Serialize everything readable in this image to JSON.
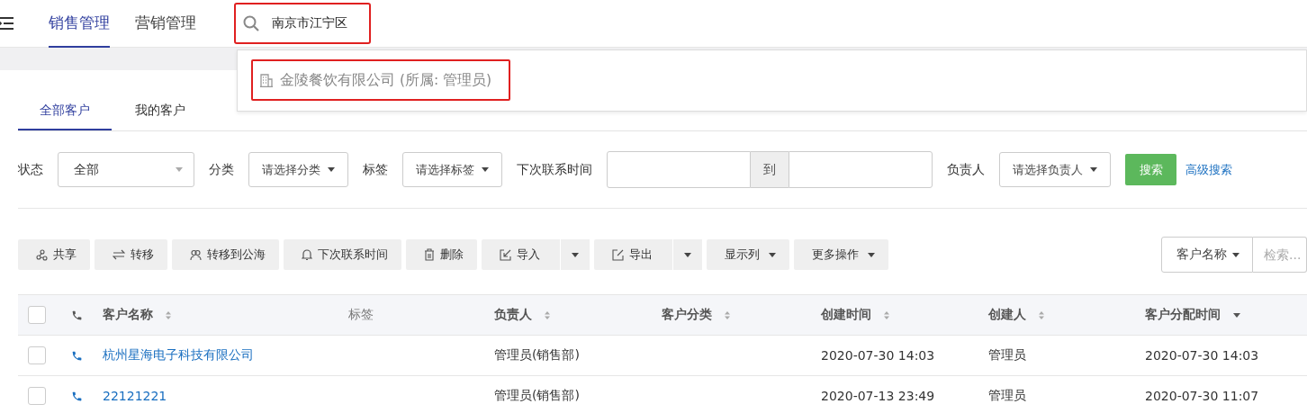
{
  "nav": {
    "tabs": [
      {
        "label": "销售管理",
        "selected": true
      },
      {
        "label": "营销管理",
        "selected": false
      }
    ]
  },
  "search": {
    "value": "南京市江宁区",
    "highlighted": true
  },
  "suggestions": [
    {
      "label": "金陵餐饮有限公司 (所属: 管理员)",
      "highlighted": true
    }
  ],
  "subtabs": [
    {
      "label": "全部客户",
      "selected": true
    },
    {
      "label": "我的客户",
      "selected": false
    }
  ],
  "filters": [
    {
      "kind": "select",
      "label": "状态",
      "value": "全部"
    },
    {
      "kind": "dropdown",
      "label": "分类",
      "value": "请选择分类"
    },
    {
      "kind": "dropdown",
      "label": "标签",
      "value": "请选择标签"
    },
    {
      "kind": "range",
      "label": "下次联系时间",
      "separator": "到"
    },
    {
      "kind": "dropdown",
      "label": "负责人",
      "value": "请选择负责人"
    }
  ],
  "search_button": "搜索",
  "advanced_search": "高级搜索",
  "toolbar": [
    {
      "kind": "share",
      "label": "共享",
      "split": false
    },
    {
      "kind": "transfer",
      "label": "转移",
      "split": false
    },
    {
      "kind": "pool",
      "label": "转移到公海",
      "split": false
    },
    {
      "kind": "reminder",
      "label": "下次联系时间",
      "split": false
    },
    {
      "kind": "delete",
      "label": "删除",
      "split": false
    },
    {
      "kind": "import",
      "label": "导入",
      "split": true
    },
    {
      "kind": "export",
      "label": "导出",
      "split": true
    },
    {
      "kind": "menu",
      "label": "显示列",
      "split": false
    },
    {
      "kind": "menu",
      "label": "更多操作",
      "split": false
    }
  ],
  "table_search": {
    "field": "客户名称",
    "placeholder": "检索..."
  },
  "table": {
    "all_checked": false,
    "columns": [
      {
        "label": "客户名称",
        "kind": "sortable"
      },
      {
        "label": "标签",
        "kind": "plain"
      },
      {
        "label": "负责人",
        "kind": "sortable"
      },
      {
        "label": "客户分类",
        "kind": "sortable"
      },
      {
        "label": "创建时间",
        "kind": "sortable"
      },
      {
        "label": "创建人",
        "kind": "sortable"
      },
      {
        "label": "客户分配时间",
        "kind": "sorted"
      }
    ],
    "rows": [
      {
        "checked": false,
        "cells": [
          "杭州星海电子科技有限公司",
          "",
          "管理员(销售部)",
          "",
          "2020-07-30 14:03",
          "管理员",
          "2020-07-30 14:03"
        ]
      },
      {
        "checked": false,
        "cells": [
          "22121221",
          "",
          "管理员(销售部)",
          "",
          "2020-07-13 23:49",
          "管理员",
          "2020-07-30 11:07"
        ]
      }
    ]
  }
}
